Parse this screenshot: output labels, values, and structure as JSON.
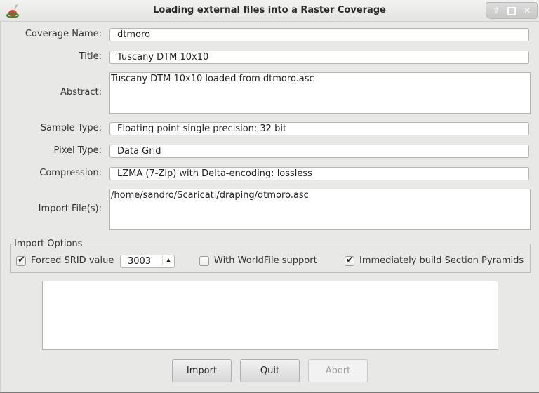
{
  "window": {
    "title": "Loading external files into a Raster Coverage",
    "controls": [
      "shade-up",
      "maximize",
      "close"
    ]
  },
  "form": {
    "coverage_name": {
      "label": "Coverage Name:",
      "value": "dtmoro"
    },
    "title": {
      "label": "Title:",
      "value": "Tuscany DTM 10x10"
    },
    "abstract": {
      "label": "Abstract:",
      "value": "Tuscany DTM 10x10 loaded from dtmoro.asc"
    },
    "sample_type": {
      "label": "Sample Type:",
      "value": "Floating point single precision: 32 bit"
    },
    "pixel_type": {
      "label": "Pixel Type:",
      "value": "Data Grid"
    },
    "compression": {
      "label": "Compression:",
      "value": "LZMA (7-Zip) with Delta-encoding: lossless"
    },
    "import_files": {
      "label": "Import File(s):",
      "value": "/home/sandro/Scaricati/draping/dtmoro.asc"
    }
  },
  "import_options": {
    "title": "Import Options",
    "forced_srid": {
      "label": "Forced SRID value",
      "checked": true,
      "value": "3003"
    },
    "worldfile": {
      "label": "With WorldFile support",
      "checked": false
    },
    "pyramids": {
      "label": "Immediately build Section Pyramids",
      "checked": true
    }
  },
  "log": "",
  "buttons": {
    "import": "Import",
    "quit": "Quit",
    "abort": "Abort"
  },
  "glyphs": {
    "check": "✔",
    "up": "▲",
    "shade": "⇧",
    "max": "▫",
    "close": "✕"
  }
}
